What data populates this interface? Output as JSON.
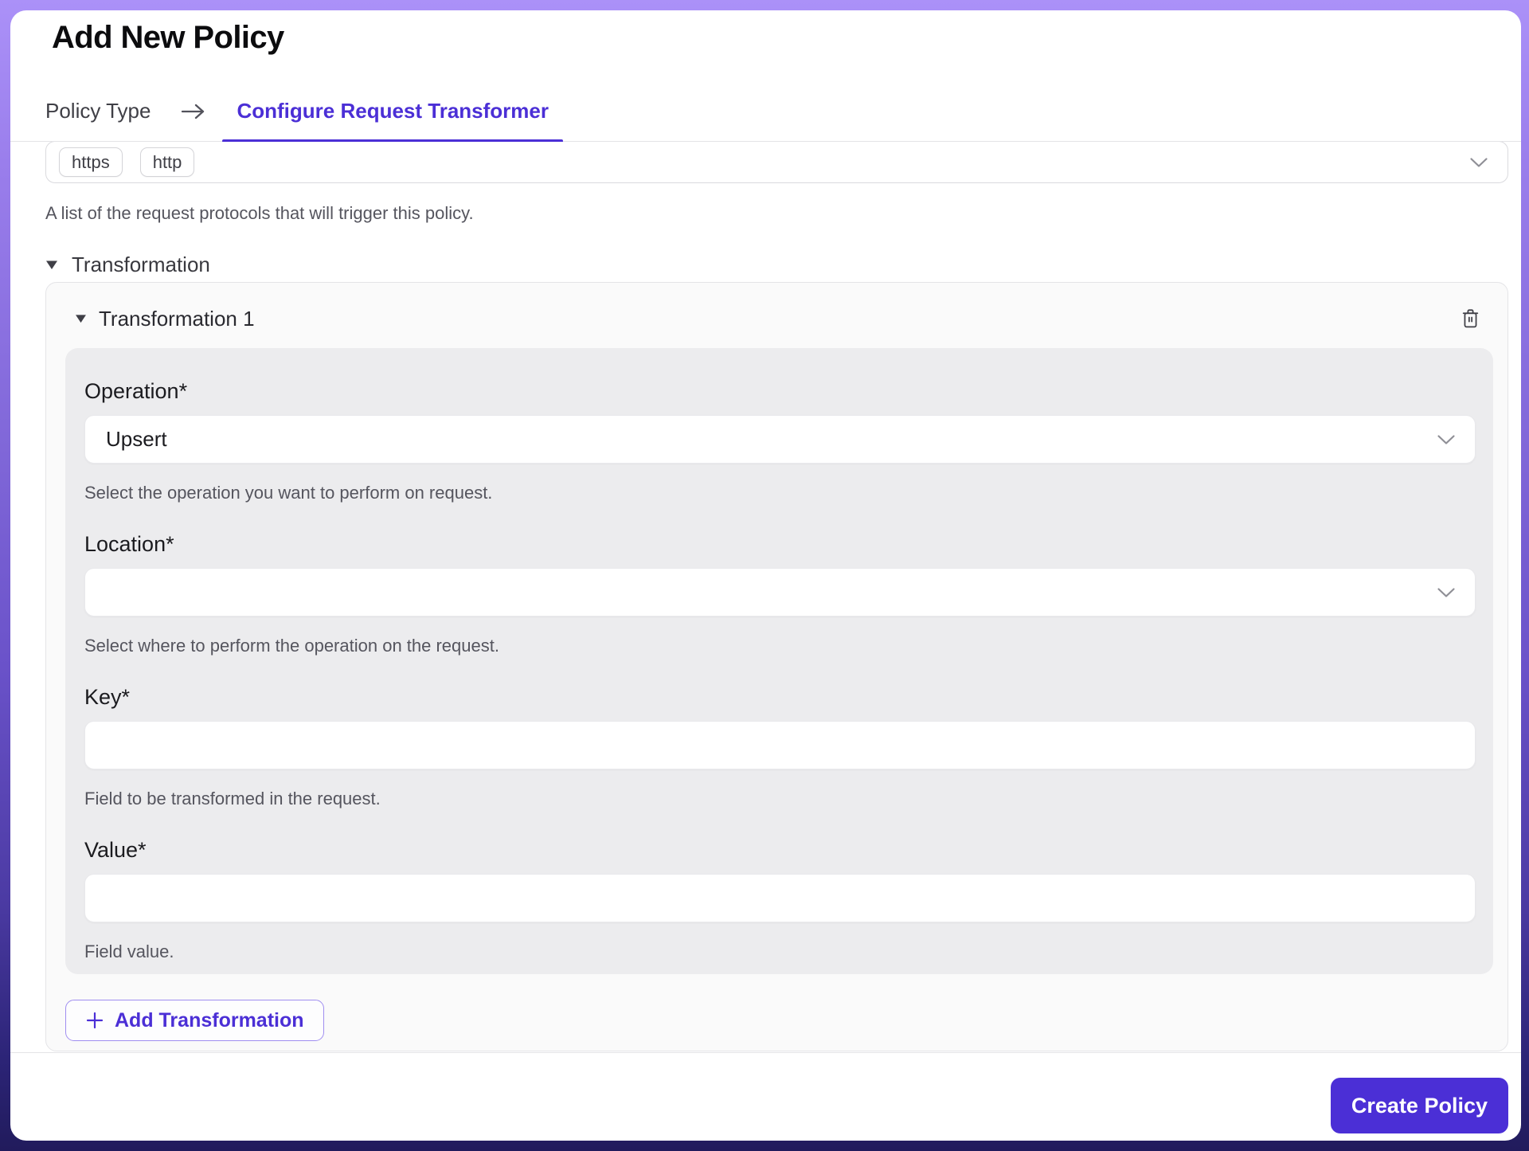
{
  "colors": {
    "accent": "#4b2fd6",
    "frame_gradient_top": "#ab91f8",
    "frame_gradient_bottom": "#211b5c",
    "card_bg": "#fafafa",
    "panel_bg": "#ececee",
    "border": "#e4e4e7",
    "helper_text": "#55555e"
  },
  "icons": {
    "arrow_right": "→",
    "caret_down": "▼",
    "chevron_down": "⌄",
    "trash": "trash-outline",
    "plus": "+"
  },
  "header": {
    "title": "Add New Policy"
  },
  "tabs": {
    "step1": "Policy Type",
    "step2": "Configure Request Transformer"
  },
  "protocols": {
    "chips": [
      "https",
      "http"
    ],
    "helper": "A list of the request protocols that will trigger this policy."
  },
  "section": {
    "title": "Transformation"
  },
  "transformation_card": {
    "title": "Transformation 1",
    "fields": [
      {
        "label": "Operation*",
        "type": "select",
        "value": "Upsert",
        "helper": "Select the operation you want to perform on request."
      },
      {
        "label": "Location*",
        "type": "select",
        "value": "",
        "helper": "Select where to perform the operation on the request."
      },
      {
        "label": "Key*",
        "type": "input",
        "value": "",
        "helper": "Field to be transformed in the request."
      },
      {
        "label": "Value*",
        "type": "input",
        "value": "",
        "helper": "Field value."
      }
    ],
    "add_button": "Add Transformation"
  },
  "footer": {
    "create_button": "Create Policy"
  }
}
